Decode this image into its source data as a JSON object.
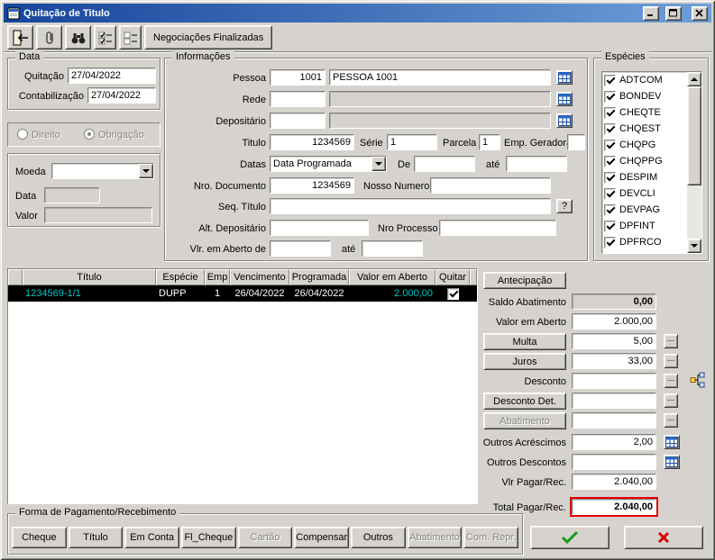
{
  "window": {
    "title": "Quitação de Titulo"
  },
  "toolbar": {
    "negociacoes_label": "Negociações Finalizadas"
  },
  "icons": {
    "help": "?",
    "more": "...",
    "exit": "exit-door",
    "attachment": "paperclip",
    "find": "binoculars",
    "check_all": "checklist-checked",
    "uncheck_all": "checklist-empty",
    "lookup": "grid-table",
    "tree": "hierarchy-tree",
    "ok": "green-check",
    "cancel": "red-x"
  },
  "data_group": {
    "title": "Data",
    "quitacao_label": "Quitação",
    "quitacao_value": "27/04/2022",
    "contabilizacao_label": "Contabilização",
    "contabilizacao_value": "27/04/2022"
  },
  "radio_group": {
    "direito_label": "Direito",
    "obrigacao_label": "Obrigação",
    "selected": "Obrigação"
  },
  "moeda_group": {
    "moeda_label": "Moeda",
    "moeda_value": "",
    "data_label": "Data",
    "data_value": "",
    "valor_label": "Valor",
    "valor_value": ""
  },
  "info": {
    "title": "Informações",
    "pessoa_label": "Pessoa",
    "pessoa_value": "1001",
    "pessoa_name": "PESSOA 1001",
    "rede_label": "Rede",
    "depositario_label": "Depositário",
    "titulo_label": "Titulo",
    "titulo_value": "1234569",
    "serie_label": "Série",
    "serie_value": "1",
    "parcela_label": "Parcela",
    "parcela_value": "1",
    "emp_geradora_label": "Emp. Geradora",
    "emp_geradora_value": "",
    "datas_label": "Datas",
    "datas_value": "Data Programada",
    "de_label": "De",
    "ate_label": "até",
    "nro_documento_label": "Nro. Documento",
    "nro_documento_value": "1234569",
    "nosso_numero_label": "Nosso Numero",
    "nosso_numero_value": "",
    "seq_titulo_label": "Seq. Título",
    "seq_titulo_value": "",
    "alt_depositario_label": "Alt. Depositário",
    "alt_depositario_value": "",
    "nro_processo_label": "Nro Processo",
    "nro_processo_value": "",
    "vlr_em_aberto_de_label": "Vlr. em Aberto de",
    "vlr_em_aberto_de_value": "",
    "vlr_em_aberto_ate_value": ""
  },
  "especies": {
    "title": "Espécies",
    "all_checked": true,
    "items": [
      "ADTCOM",
      "BONDEV",
      "CHEQTE",
      "CHQEST",
      "CHQPG",
      "CHQPPG",
      "DESPIM",
      "DEVCLI",
      "DEVPAG",
      "DPFINT",
      "DPFRCO"
    ]
  },
  "grid": {
    "columns": [
      "",
      "Título",
      "Espécie",
      "Emp",
      "Vencimento",
      "Programada",
      "Valor em Aberto",
      "Quitar"
    ],
    "rows": [
      {
        "titulo": "1234569-1/1",
        "especie": "DUPP",
        "emp": "1",
        "vencimento": "26/04/2022",
        "programada": "26/04/2022",
        "valor_em_aberto": "2.000,00",
        "quitar": true
      }
    ]
  },
  "right_panel": {
    "antecipacao_label": "Antecipação",
    "saldo_abatimento_label": "Saldo Abatimento",
    "saldo_abatimento_value": "0,00",
    "valor_em_aberto_label": "Valor em Aberto",
    "valor_em_aberto_value": "2.000,00",
    "multa_label": "Multa",
    "multa_value": "5,00",
    "juros_label": "Juros",
    "juros_value": "33,00",
    "desconto_label": "Desconto",
    "desconto_value": "",
    "desconto_det_label": "Desconto Det.",
    "desconto_det_value": "",
    "abatimento_label": "Abatimento",
    "abatimento_value": "",
    "outros_acrescimos_label": "Outros Acréscimos",
    "outros_acrescimos_value": "2,00",
    "outros_descontos_label": "Outros Descontos",
    "outros_descontos_value": "",
    "vlr_pagar_label": "Vlr Pagar/Rec.",
    "vlr_pagar_value": "2.040,00",
    "total_pagar_label": "Total Pagar/Rec.",
    "total_pagar_value": "2.040,00"
  },
  "payment": {
    "title": "Forma de Pagamento/Recebimento",
    "buttons": [
      {
        "label": "Cheque",
        "enabled": true
      },
      {
        "label": "Título",
        "enabled": true
      },
      {
        "label": "Em Conta",
        "enabled": true
      },
      {
        "label": "Fl_Cheque",
        "enabled": true
      },
      {
        "label": "Cartão",
        "enabled": false
      },
      {
        "label": "Compensar",
        "enabled": true
      },
      {
        "label": "Outros",
        "enabled": true
      },
      {
        "label": "Abatimento",
        "enabled": false
      },
      {
        "label": "Com. Repr.",
        "enabled": false
      }
    ]
  },
  "colors": {
    "flag_border": "#e00000",
    "selected_row_bg": "#000000",
    "selected_row_accent": "#00c8c8"
  }
}
